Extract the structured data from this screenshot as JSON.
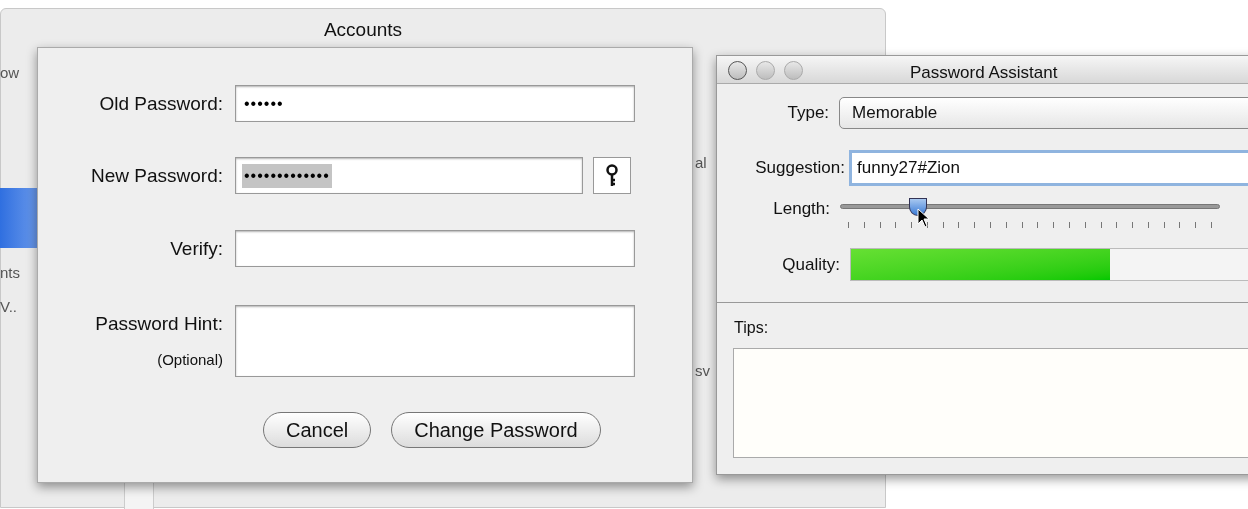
{
  "background_window": {
    "title": "Accounts",
    "fragments": [
      "ow",
      "nts",
      "V..",
      "al",
      "sv"
    ]
  },
  "change_password_sheet": {
    "fields": [
      {
        "kind": "password",
        "label": "Old Password:",
        "value": "••••••",
        "selected_text": false,
        "key_button": false
      },
      {
        "kind": "password",
        "label": "New Password:",
        "value": "•••••••••••••",
        "selected_text": true,
        "key_button": true
      },
      {
        "kind": "password",
        "label": "Verify:",
        "key_button": false
      },
      {
        "kind": "hint",
        "label": "Password Hint:",
        "sublabel": "(Optional)",
        "key_button": false
      }
    ],
    "buttons": [
      {
        "label": "Cancel",
        "default": false
      },
      {
        "label": "Change Password",
        "default": false
      }
    ]
  },
  "password_assistant": {
    "title": "Password Assistant",
    "type": {
      "label": "Type:",
      "value": "Memorable"
    },
    "suggestion": {
      "label": "Suggestion:",
      "value": "funny27#Zion"
    },
    "length": {
      "label": "Length:",
      "level": 0.19
    },
    "quality": {
      "label": "Quality:",
      "level": 0.65
    },
    "tips": {
      "label": "Tips:"
    }
  }
}
